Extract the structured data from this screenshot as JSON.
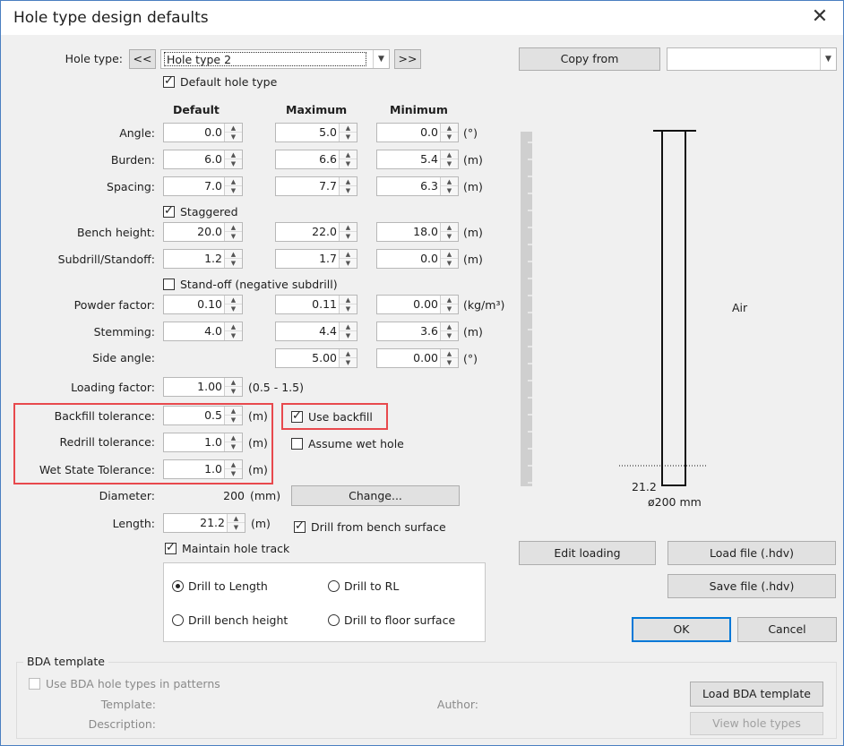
{
  "window": {
    "title": "Hole type design defaults",
    "close_glyph": "✕"
  },
  "hole_type": {
    "label": "Hole type:",
    "prev": "<<",
    "next": ">>",
    "value": "Hole type 2",
    "default_label": "Default hole type",
    "default_checked": true
  },
  "copy_from": {
    "button": "Copy from",
    "value": ""
  },
  "columns": {
    "default": "Default",
    "maximum": "Maximum",
    "minimum": "Minimum"
  },
  "rows": {
    "angle": {
      "label": "Angle:",
      "def": "0.0",
      "max": "5.0",
      "min": "0.0",
      "unit": "(°)"
    },
    "burden": {
      "label": "Burden:",
      "def": "6.0",
      "max": "6.6",
      "min": "5.4",
      "unit": "(m)"
    },
    "spacing": {
      "label": "Spacing:",
      "def": "7.0",
      "max": "7.7",
      "min": "6.3",
      "unit": "(m)"
    },
    "bench": {
      "label": "Bench height:",
      "def": "20.0",
      "max": "22.0",
      "min": "18.0",
      "unit": "(m)"
    },
    "subdrill": {
      "label": "Subdrill/Standoff:",
      "def": "1.2",
      "max": "1.7",
      "min": "0.0",
      "unit": "(m)"
    },
    "powder": {
      "label": "Powder factor:",
      "def": "0.10",
      "max": "0.11",
      "min": "0.00",
      "unit": "(kg/m³)"
    },
    "stemming": {
      "label": "Stemming:",
      "def": "4.0",
      "max": "4.4",
      "min": "3.6",
      "unit": "(m)"
    },
    "side": {
      "label": "Side angle:",
      "max": "5.00",
      "min": "0.00",
      "unit": "(°)"
    }
  },
  "staggered": {
    "label": "Staggered",
    "checked": true
  },
  "standoff": {
    "label": "Stand-off (negative subdrill)",
    "checked": false
  },
  "loading_factor": {
    "label": "Loading factor:",
    "value": "1.00",
    "range": "(0.5 - 1.5)"
  },
  "backfill_tol": {
    "label": "Backfill tolerance:",
    "value": "0.5",
    "unit": "(m)"
  },
  "redrill_tol": {
    "label": "Redrill tolerance:",
    "value": "1.0",
    "unit": "(m)"
  },
  "wet_tol": {
    "label": "Wet State Tolerance:",
    "value": "1.0",
    "unit": "(m)"
  },
  "use_backfill": {
    "label": "Use backfill",
    "checked": true
  },
  "assume_wet": {
    "label": "Assume wet hole",
    "checked": false
  },
  "diameter": {
    "label": "Diameter:",
    "value": "200",
    "unit": "(mm)",
    "change": "Change..."
  },
  "length": {
    "label": "Length:",
    "value": "21.2",
    "unit": "(m)"
  },
  "drill_from_bench": {
    "label": "Drill from bench surface",
    "checked": true
  },
  "maintain_track": {
    "label": "Maintain hole track",
    "checked": true
  },
  "drill_options": {
    "to_length": "Drill to Length",
    "to_rl": "Drill to RL",
    "bench_height": "Drill bench height",
    "floor_surface": "Drill to floor surface",
    "selected": "to_length"
  },
  "diagram": {
    "air_label": "Air",
    "depth_label": "21.2",
    "diameter_label": "ø200 mm"
  },
  "buttons": {
    "edit_loading": "Edit loading",
    "load_file": "Load file (.hdv)",
    "save_file": "Save file (.hdv)",
    "ok": "OK",
    "cancel": "Cancel"
  },
  "bda": {
    "group_title": "BDA template",
    "use_label": "Use BDA hole types in patterns",
    "template_label": "Template:",
    "author_label": "Author:",
    "description_label": "Description:",
    "load_btn": "Load BDA template",
    "view_btn": "View hole types"
  },
  "colors": {
    "highlight": "#e8494d",
    "accent": "#0078d7",
    "window_bg": "#f0f0f0"
  }
}
